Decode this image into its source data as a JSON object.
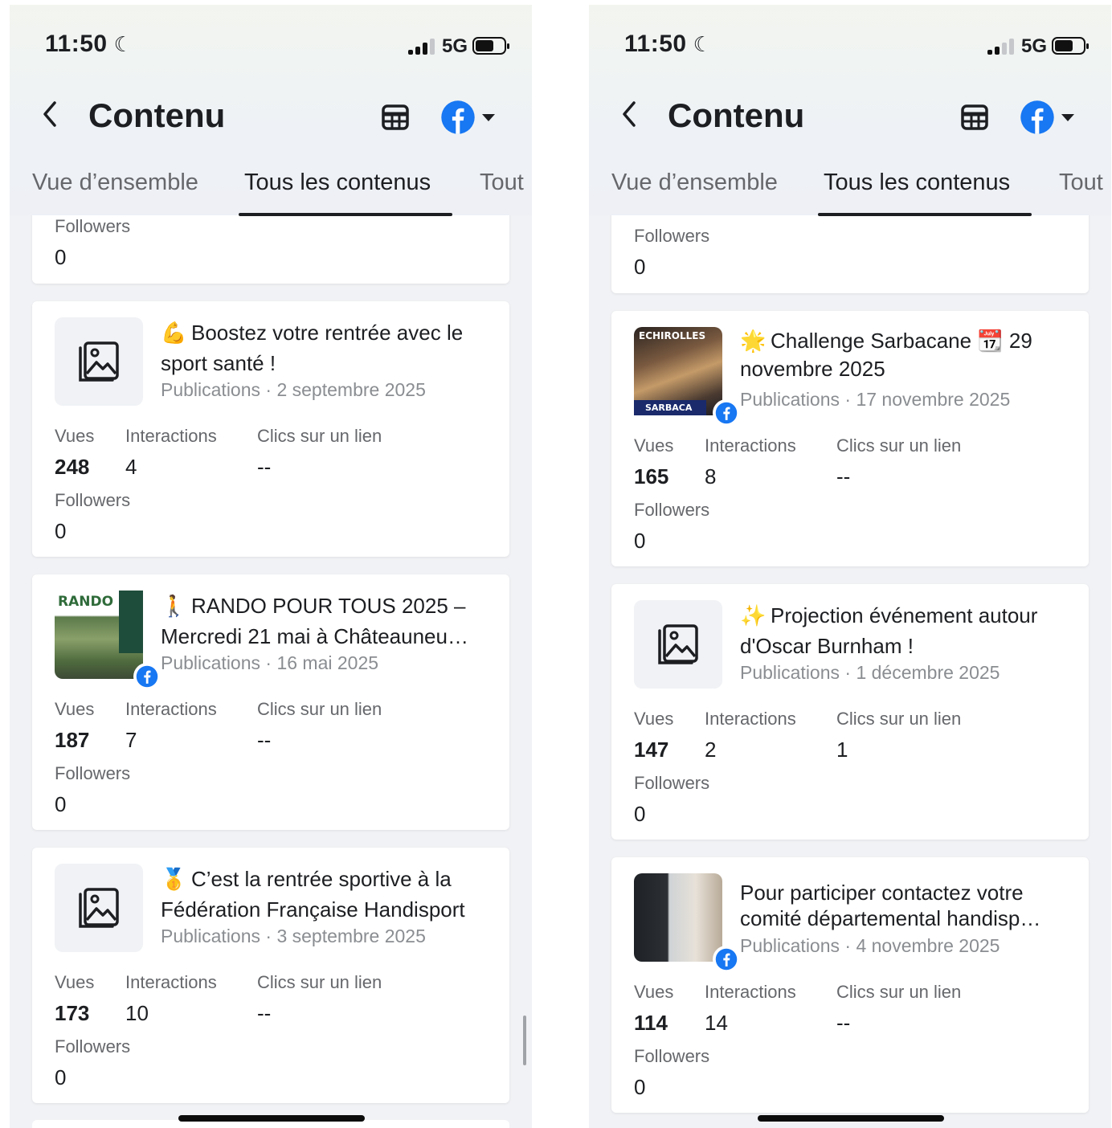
{
  "status_bar": {
    "time": "11:50",
    "network": "5G"
  },
  "header": {
    "title": "Contenu"
  },
  "tabs": [
    {
      "label": "Vue d’ensemble"
    },
    {
      "label": "Tous les contenus"
    },
    {
      "label": "Tout"
    }
  ],
  "labels": {
    "views": "Vues",
    "interactions": "Interactions",
    "link_clicks": "Clics sur un lien",
    "followers": "Followers"
  },
  "colors": {
    "facebook_blue": "#1877f2",
    "active_tab": "#1c1e21",
    "muted_text": "#65676b"
  },
  "left": {
    "top_fragment": {
      "followers": "0"
    },
    "posts": [
      {
        "emoji": "💪",
        "title": "Boostez votre rentrée avec le sport santé !",
        "meta": "Publications · 2 septembre 2025",
        "thumbnail": "image-placeholder-icon",
        "views": "248",
        "interactions": "4",
        "link_clicks": "--",
        "followers": "0"
      },
      {
        "emoji": "🚶",
        "title": "RANDO POUR TOUS 2025 – Mercredi 21 mai à Châteauneu…",
        "meta": "Publications · 16 mai 2025",
        "thumbnail": "photo-rando",
        "thumb_text": "RANDO",
        "views": "187",
        "interactions": "7",
        "link_clicks": "--",
        "followers": "0"
      },
      {
        "emoji": "🥇",
        "title": "C’est la rentrée sportive à la Fédération Française Handisport",
        "meta": "Publications · 3 septembre 2025",
        "thumbnail": "image-placeholder-icon",
        "views": "173",
        "interactions": "10",
        "link_clicks": "--",
        "followers": "0"
      }
    ]
  },
  "right": {
    "top_fragment": {
      "followers": "0"
    },
    "posts": [
      {
        "emoji": "🌟",
        "title": "Challenge Sarbacane 📆 29 novembre 2025",
        "meta": "Publications · 17 novembre 2025",
        "thumbnail": "photo-sarbacane",
        "thumb_text": "ECHIROLLES",
        "thumb_text_2": "SARBACA",
        "views": "165",
        "interactions": "8",
        "link_clicks": "--",
        "followers": "0"
      },
      {
        "emoji": "✨",
        "title": "Projection événement autour d'Oscar Burnham !",
        "meta": "Publications · 1 décembre 2025",
        "thumbnail": "image-placeholder-icon",
        "views": "147",
        "interactions": "2",
        "link_clicks": "1",
        "followers": "0"
      },
      {
        "emoji": "",
        "title": "Pour participer contactez votre comité départemental handisp…",
        "meta": "Publications · 4 novembre 2025",
        "thumbnail": "photo-contact",
        "views": "114",
        "interactions": "14",
        "link_clicks": "--",
        "followers": "0"
      }
    ]
  }
}
